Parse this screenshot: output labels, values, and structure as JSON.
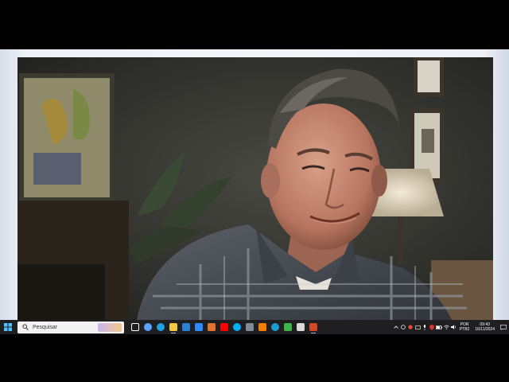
{
  "taskbar": {
    "search_placeholder": "Pesquisar",
    "pinned_apps": [
      {
        "name": "task-view-icon",
        "color": "#ffffff"
      },
      {
        "name": "copilot-icon",
        "color": "#5aa3ff"
      },
      {
        "name": "edge-icon",
        "color": "#1fa0e0"
      },
      {
        "name": "file-explorer-icon",
        "color": "#f2c744"
      },
      {
        "name": "mail-icon",
        "color": "#2a7fd6"
      },
      {
        "name": "zoom-icon",
        "color": "#2d8cff"
      },
      {
        "name": "fox-app-icon",
        "color": "#e2742b"
      },
      {
        "name": "youtube-icon",
        "color": "#ff0000"
      },
      {
        "name": "skype-icon",
        "color": "#00aff0"
      },
      {
        "name": "photos-icon",
        "color": "#7e8a96"
      },
      {
        "name": "blogger-icon",
        "color": "#f57d00"
      },
      {
        "name": "media-player-icon",
        "color": "#1c9bd6"
      },
      {
        "name": "checkmark-app-icon",
        "color": "#3bb54a"
      },
      {
        "name": "document-icon",
        "color": "#d9d9d9"
      },
      {
        "name": "powerpoint-icon",
        "color": "#d24726"
      }
    ],
    "language": {
      "line1": "POR",
      "line2": "PTB2"
    },
    "time": "09:43",
    "date": "16/11/2024"
  }
}
